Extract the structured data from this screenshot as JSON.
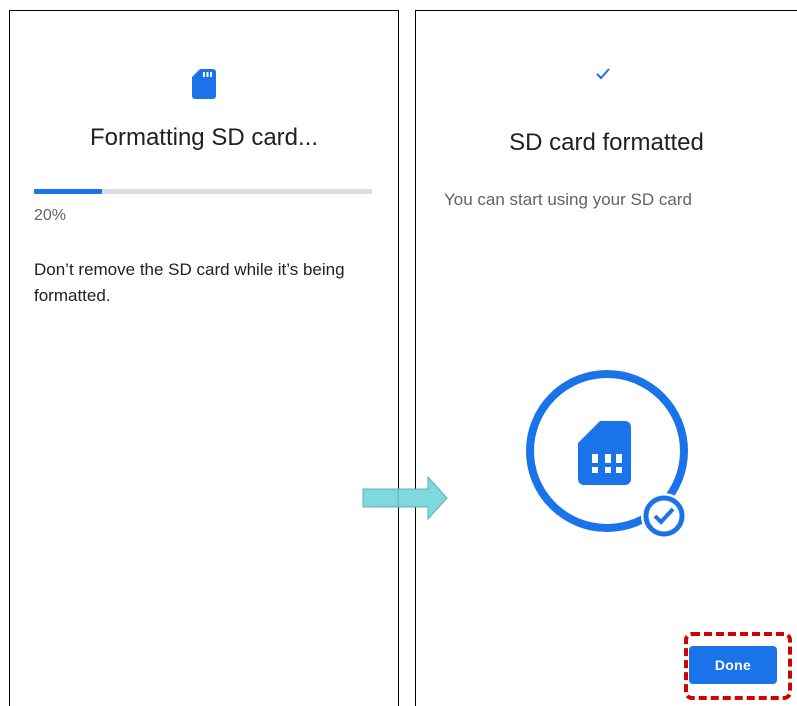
{
  "formatting_screen": {
    "title": "Formatting SD card...",
    "progress_label": "20%",
    "progress_fraction": 0.2,
    "warning": "Don’t remove the SD card while it’s being formatted.",
    "icon": "sd-card-icon"
  },
  "formatted_screen": {
    "title": "SD card formatted",
    "subtitle": "You can start using your SD card",
    "done_label": "Done",
    "icons": [
      "checkmark-icon",
      "sd-card-icon",
      "check-circle-icon"
    ]
  },
  "colors": {
    "accent": "#1a73e8",
    "highlight": "#d40000",
    "arrow": "#7fd8dc"
  }
}
